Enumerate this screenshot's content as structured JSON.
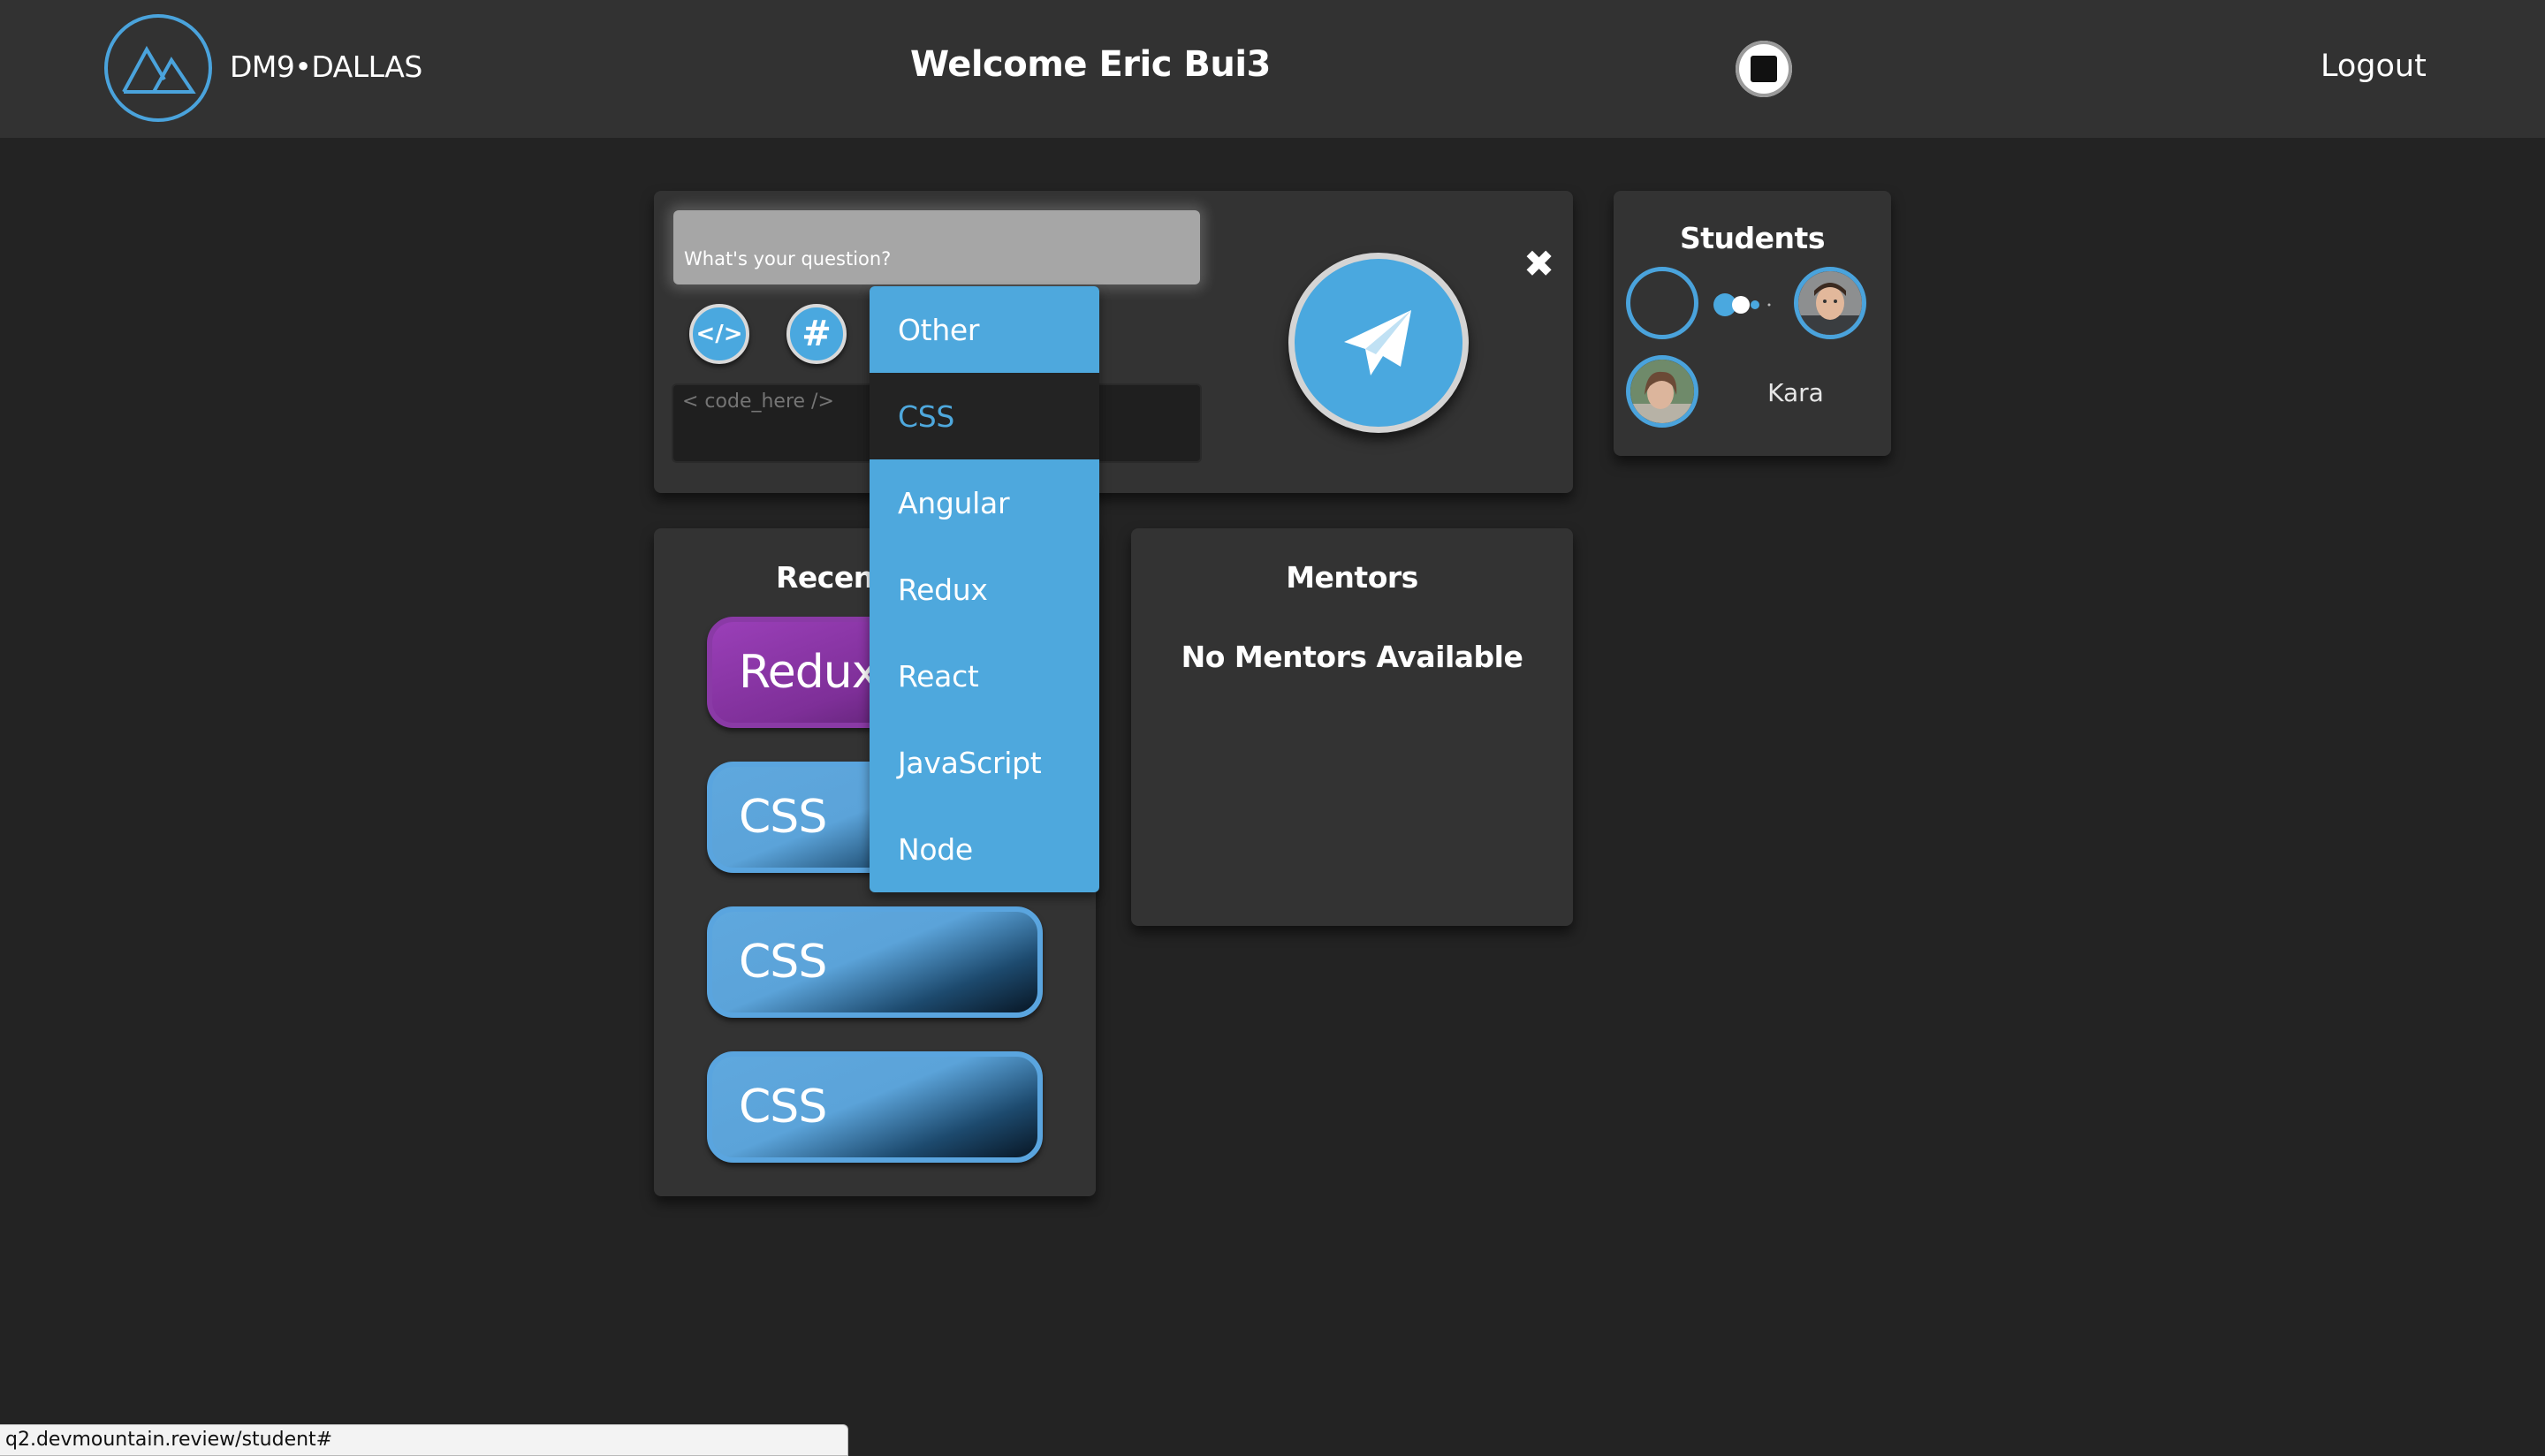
{
  "header": {
    "brand": "DM9•DALLAS",
    "welcome": "Welcome Eric Bui3",
    "logout": "Logout"
  },
  "question": {
    "placeholder": "What's your question?",
    "code_placeholder": "< code_here />",
    "code_icon": "</>",
    "hash_icon": "#",
    "close_glyph": "✖"
  },
  "topics_dropdown": {
    "selected": "CSS",
    "items": [
      "Other",
      "CSS",
      "Angular",
      "Redux",
      "React",
      "JavaScript",
      "Node"
    ]
  },
  "students": {
    "title": "Students",
    "names": [
      "Kara"
    ]
  },
  "recent": {
    "title": "Recent",
    "items": [
      "Redux",
      "CSS",
      "CSS",
      "CSS"
    ]
  },
  "mentors": {
    "title": "Mentors",
    "empty_text": "No Mentors Available"
  },
  "status_bar": {
    "url": "q2.devmountain.review/student#"
  },
  "colors": {
    "accent": "#4ea8dd",
    "background": "#232323",
    "card": "#333333",
    "redux_purple": "#8a3aa6"
  }
}
